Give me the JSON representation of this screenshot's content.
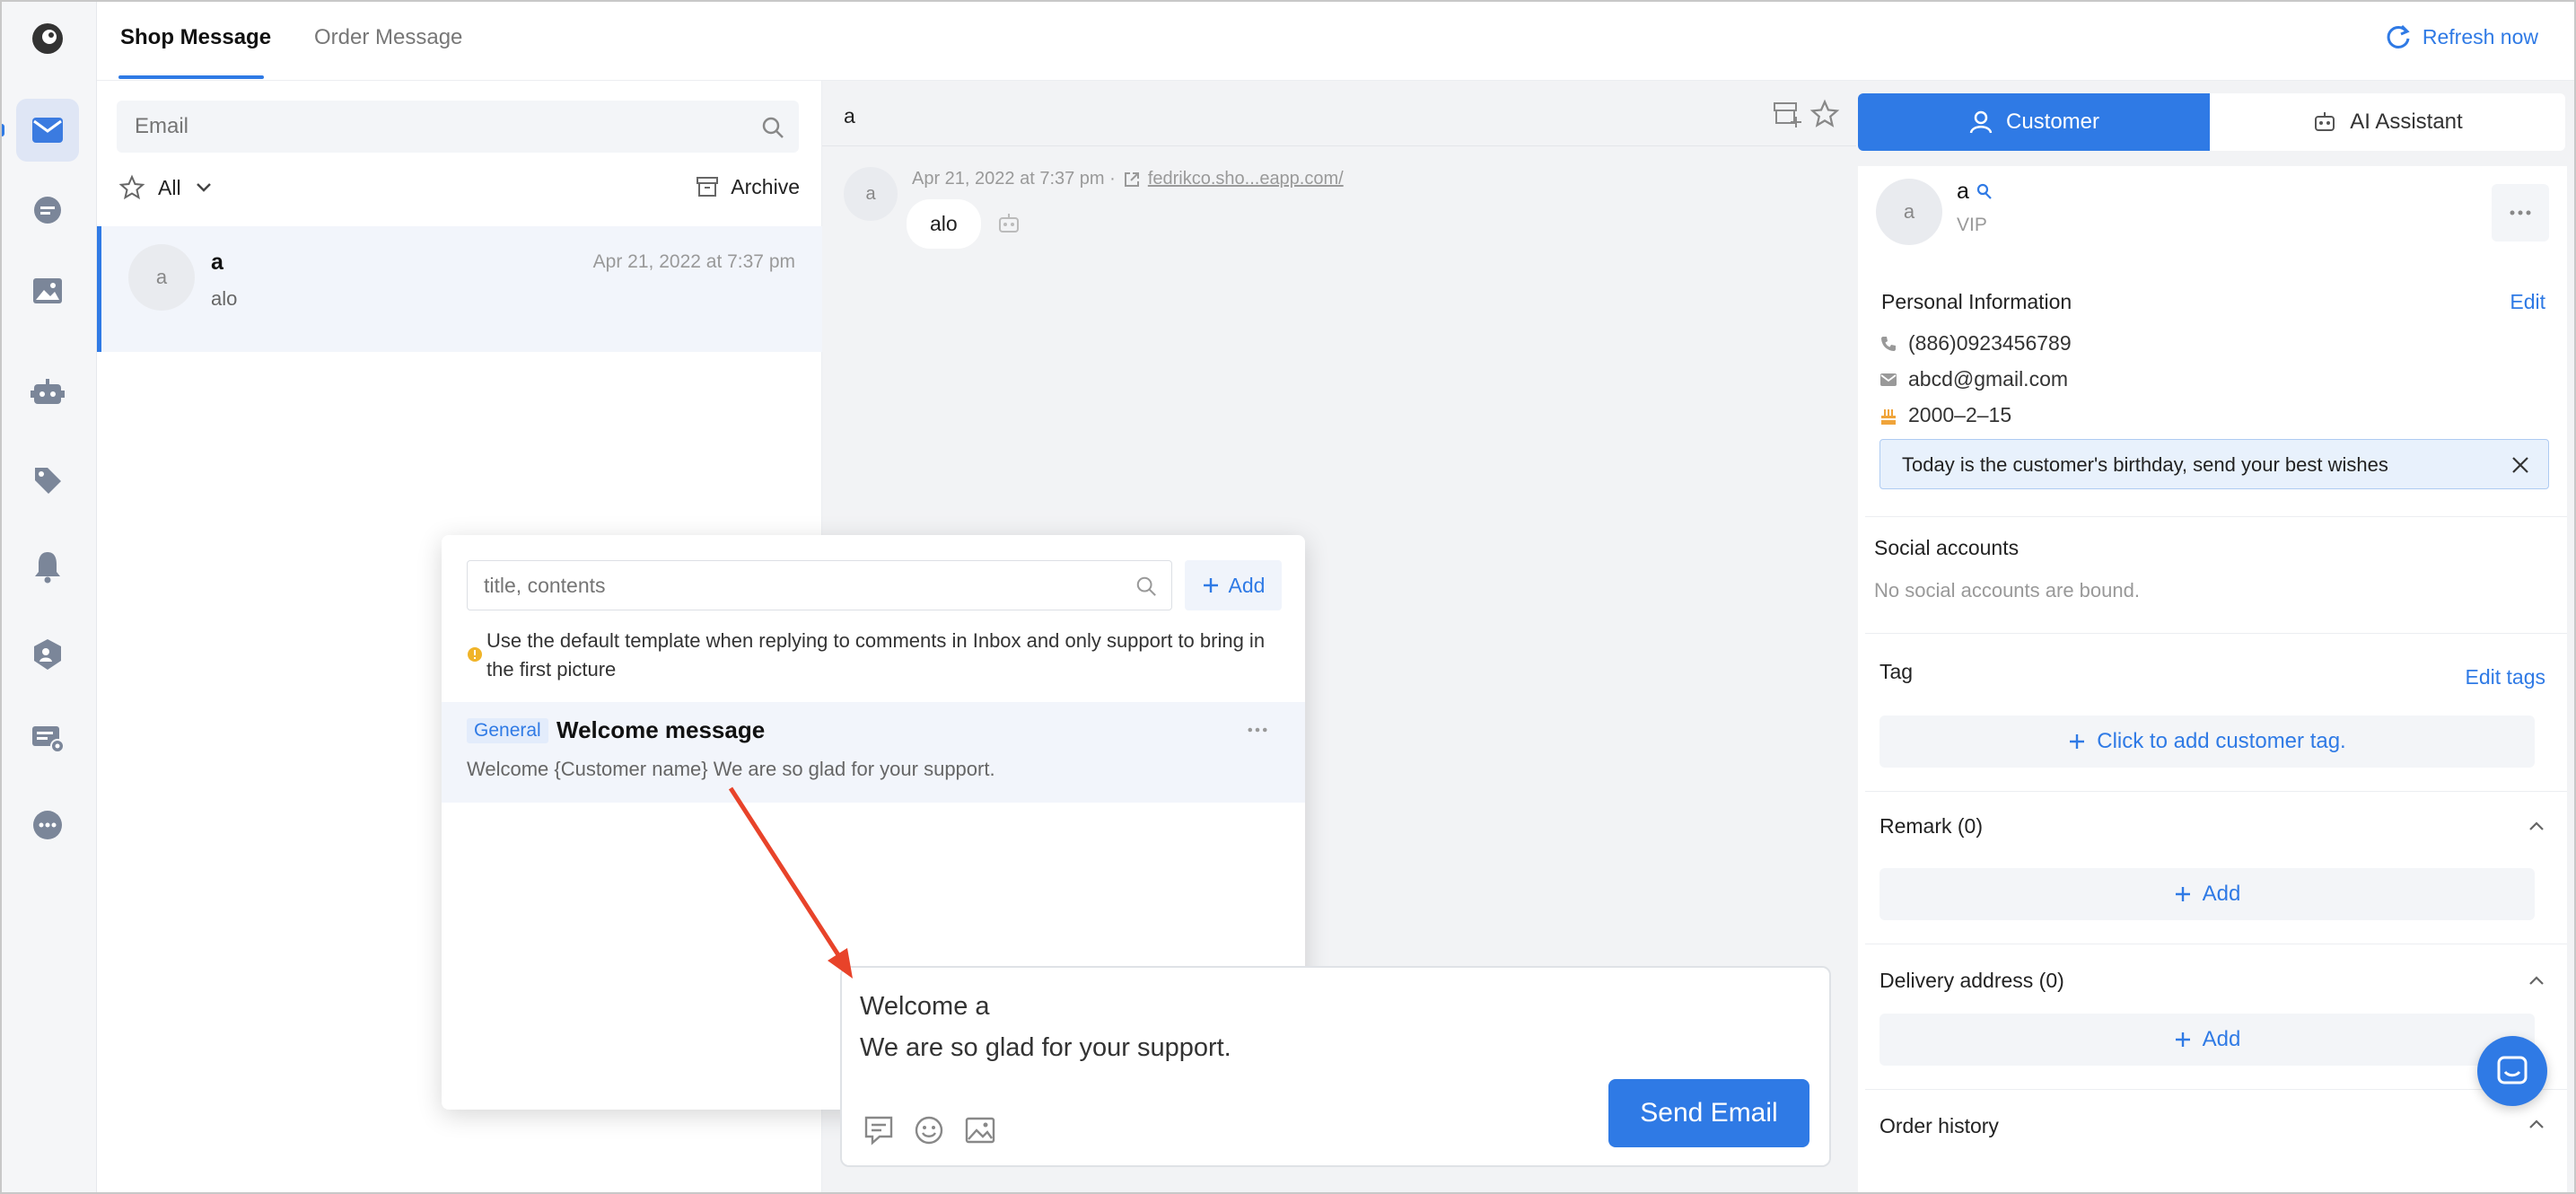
{
  "nav": [
    "logo-icon",
    "mail-icon",
    "chat-icon",
    "image-icon",
    "robot-icon",
    "tag-icon",
    "bell-icon",
    "shield-user-icon",
    "message-settings-icon",
    "more-icon"
  ],
  "tabs": {
    "shop": "Shop Message",
    "order": "Order Message"
  },
  "refresh": "Refresh now",
  "list": {
    "search_placeholder": "Email",
    "filter": "All",
    "archive": "Archive",
    "item": {
      "avatar": "a",
      "name": "a",
      "time": "Apr 21, 2022 at 7:37 pm",
      "preview": "alo"
    }
  },
  "chat": {
    "title": "a",
    "avatar": "a",
    "meta_time": "Apr 21, 2022 at 7:37 pm ·",
    "meta_link": "fedrikco.sho...eapp.com/",
    "bubble": "alo"
  },
  "template_popup": {
    "search_placeholder": "title, contents",
    "add": "Add",
    "notice": "Use the default template when replying to comments in Inbox and only support to bring in the first picture",
    "item": {
      "tag": "General",
      "title": "Welcome message",
      "body": "Welcome {Customer name} We are so glad for your support."
    }
  },
  "composer": {
    "line1": "Welcome a",
    "line2": "We are so glad for your support.",
    "send": "Send Email"
  },
  "right": {
    "tab_customer": "Customer",
    "tab_ai": "AI Assistant",
    "avatar": "a",
    "name": "a",
    "level": "VIP",
    "personal_title": "Personal Information",
    "edit": "Edit",
    "phone": "(886)0923456789",
    "email": "abcd@gmail.com",
    "birthday": "2000–2–15",
    "birthday_notice": "Today is the customer's birthday, send your best wishes",
    "social_title": "Social accounts",
    "social_empty": "No social accounts are bound.",
    "tag_title": "Tag",
    "edit_tags": "Edit tags",
    "add_tag": "Click to add customer tag.",
    "remark_title": "Remark (0)",
    "remark_add": "Add",
    "delivery_title": "Delivery address (0)",
    "delivery_add": "Add",
    "order_title": "Order history"
  },
  "colors": {
    "accent": "#2f7ae5",
    "arrow": "#e8432a",
    "birthday_bg": "#e8f1fc"
  }
}
